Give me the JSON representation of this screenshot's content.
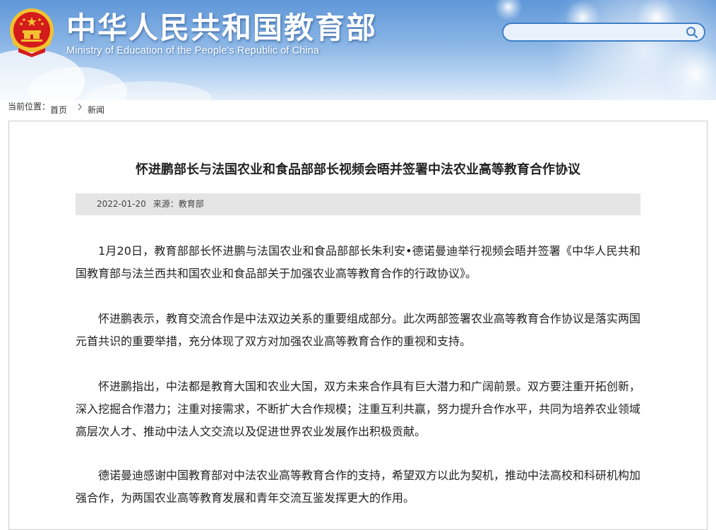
{
  "site": {
    "title_cn": "中华人民共和国教育部",
    "title_en": "Ministry of Education of the People's Republic of China",
    "emblem_icon": "national-emblem-icon",
    "search": {
      "value": "",
      "icon": "search-icon"
    }
  },
  "breadcrumb": {
    "label": "当前位置：",
    "home": "首页",
    "separator_icon": "chevron-right-icon",
    "current": "新闻"
  },
  "article": {
    "title": "怀进鹏部长与法国农业和食品部部长视频会晤并签署中法农业高等教育合作协议",
    "date": "2022-01-20",
    "source": "来源：教育部",
    "paragraphs": [
      "1月20日，教育部部长怀进鹏与法国农业和食品部部长朱利安•德诺曼迪举行视频会晤并签署《中华人民共和国教育部与法兰西共和国农业和食品部关于加强农业高等教育合作的行政协议》。",
      "怀进鹏表示，教育交流合作是中法双边关系的重要组成部分。此次两部签署农业高等教育合作协议是落实两国元首共识的重要举措，充分体现了双方对加强农业高等教育合作的重视和支持。",
      "怀进鹏指出，中法都是教育大国和农业大国，双方未来合作具有巨大潜力和广阔前景。双方要注重开拓创新，深入挖掘合作潜力；注重对接需求，不断扩大合作规模；注重互利共赢，努力提升合作水平，共同为培养农业领域高层次人才、推动中法人文交流以及促进世界农业发展作出积极贡献。",
      "德诺曼迪感谢中国教育部对中法农业高等教育合作的支持，希望双方以此为契机，推动中法高校和科研机构加强合作，为两国农业高等教育发展和青年交流互鉴发挥更大的作用。"
    ]
  },
  "colors": {
    "header_sky": "#5f97d8",
    "search_border": "#3f7fc6",
    "meta_bar": "#e5e5e5",
    "content_border": "#cccccc",
    "emblem_red": "#d51c1c",
    "emblem_gold": "#f2c230"
  }
}
